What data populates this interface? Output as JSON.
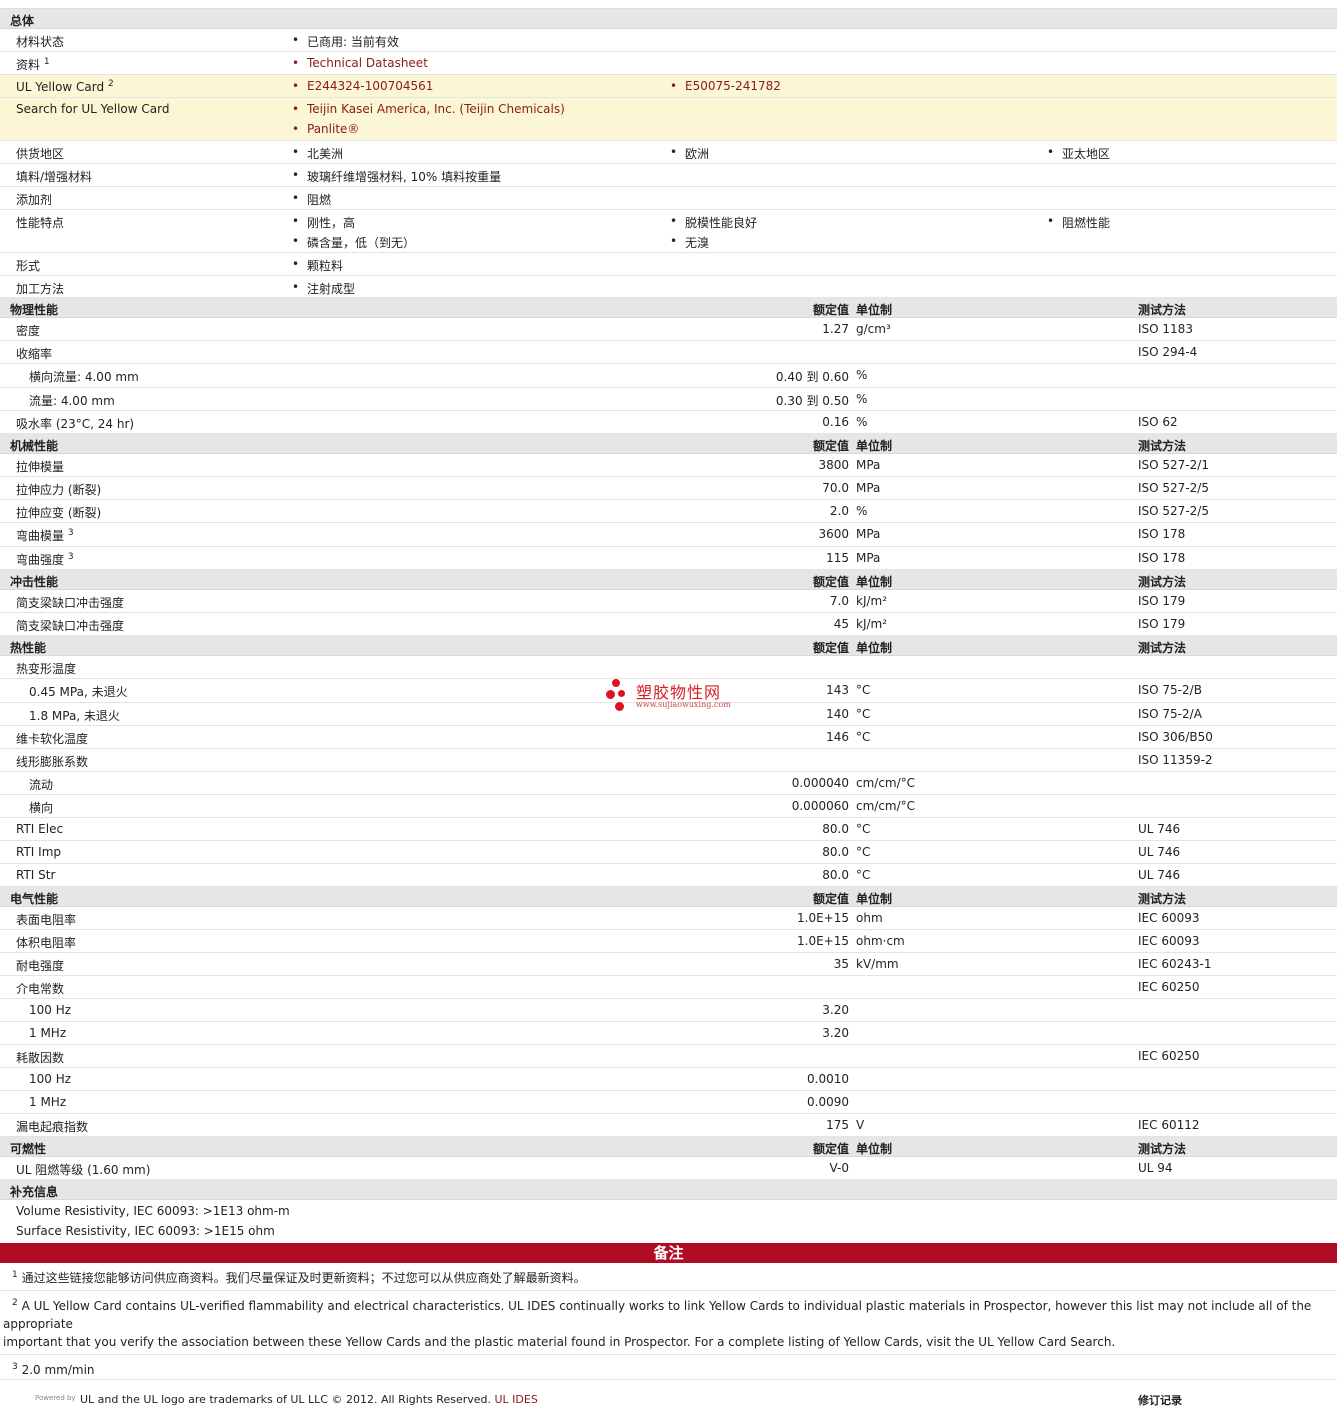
{
  "general": {
    "title": "总体",
    "status_label": "材料状态",
    "status_value": "已商用: 当前有效",
    "docs_label": "资料",
    "docs_sup": "1",
    "docs_link": "Technical Datasheet",
    "ulcard_label": "UL Yellow Card",
    "ulcard_sup": "2",
    "ulcard_link1": "E244324-100704561",
    "ulcard_link2": "E50075-241782",
    "search_label": "Search for UL Yellow Card",
    "search_link1": "Teijin Kasei America, Inc. (Teijin Chemicals)",
    "search_link2": "Panlite®",
    "region_label": "供货地区",
    "region": [
      "北美洲",
      "欧洲",
      "亚太地区"
    ],
    "filler_label": "填料/增强材料",
    "filler_value": "玻璃纤维增强材料, 10% 填料按重量",
    "additive_label": "添加剂",
    "additive_value": "阻燃",
    "features_label": "性能特点",
    "features": [
      "刚性，高",
      "脱模性能良好",
      "阻燃性能",
      "磷含量，低（到无）",
      "无溴"
    ],
    "form_label": "形式",
    "form_value": "颗粒料",
    "process_label": "加工方法",
    "process_value": "注射成型"
  },
  "headers": {
    "nominal": "额定值",
    "unit": "单位制",
    "method": "测试方法"
  },
  "physical": {
    "title": "物理性能",
    "rows": [
      {
        "label": "密度",
        "value": "1.27",
        "unit": "g/cm³",
        "method": "ISO 1183"
      },
      {
        "label": "收缩率",
        "value": "",
        "unit": "",
        "method": "ISO 294-4"
      },
      {
        "label": "横向流量: 4.00 mm",
        "value": "0.40 到  0.60",
        "unit": "%",
        "method": ""
      },
      {
        "label": "流量: 4.00 mm",
        "value": "0.30 到  0.50",
        "unit": "%",
        "method": ""
      },
      {
        "label": "吸水率  (23°C, 24 hr)",
        "value": "0.16",
        "unit": "%",
        "method": "ISO 62"
      }
    ]
  },
  "mechanical": {
    "title": "机械性能",
    "rows": [
      {
        "label": "拉伸模量",
        "value": "3800",
        "unit": "MPa",
        "method": "ISO 527-2/1"
      },
      {
        "label": "拉伸应力  (断裂)",
        "value": "70.0",
        "unit": "MPa",
        "method": "ISO 527-2/5"
      },
      {
        "label": "拉伸应变  (断裂)",
        "value": "2.0",
        "unit": "%",
        "method": "ISO 527-2/5"
      },
      {
        "label": "弯曲模量",
        "sup": "3",
        "value": "3600",
        "unit": "MPa",
        "method": "ISO 178"
      },
      {
        "label": "弯曲强度",
        "sup": "3",
        "value": "115",
        "unit": "MPa",
        "method": "ISO 178"
      }
    ]
  },
  "impact": {
    "title": "冲击性能",
    "rows": [
      {
        "label": "简支梁缺口冲击强度",
        "value": "7.0",
        "unit": "kJ/m²",
        "method": "ISO 179"
      },
      {
        "label": "简支梁缺口冲击强度",
        "value": "45",
        "unit": "kJ/m²",
        "method": "ISO 179"
      }
    ]
  },
  "thermal": {
    "title": "热性能",
    "rows": [
      {
        "label": "热变形温度",
        "value": "",
        "unit": "",
        "method": ""
      },
      {
        "label": "0.45 MPa, 未退火",
        "value": "143",
        "unit": "°C",
        "method": "ISO 75-2/B"
      },
      {
        "label": "1.8 MPa, 未退火",
        "value": "140",
        "unit": "°C",
        "method": "ISO 75-2/A"
      },
      {
        "label": "维卡软化温度",
        "value": "146",
        "unit": "°C",
        "method": "ISO 306/B50"
      },
      {
        "label": "线形膨胀系数",
        "value": "",
        "unit": "",
        "method": "ISO 11359-2"
      },
      {
        "label": "流动",
        "value": "0.000040",
        "unit": "cm/cm/°C",
        "method": ""
      },
      {
        "label": "横向",
        "value": "0.000060",
        "unit": "cm/cm/°C",
        "method": ""
      },
      {
        "label": "RTI Elec",
        "value": "80.0",
        "unit": "°C",
        "method": "UL 746"
      },
      {
        "label": "RTI Imp",
        "value": "80.0",
        "unit": "°C",
        "method": "UL 746"
      },
      {
        "label": "RTI Str",
        "value": "80.0",
        "unit": "°C",
        "method": "UL 746"
      }
    ]
  },
  "electrical": {
    "title": "电气性能",
    "rows": [
      {
        "label": "表面电阻率",
        "value": "1.0E+15",
        "unit": "ohm",
        "method": "IEC 60093"
      },
      {
        "label": "体积电阻率",
        "value": "1.0E+15",
        "unit": "ohm·cm",
        "method": "IEC 60093"
      },
      {
        "label": "耐电强度",
        "value": "35",
        "unit": "kV/mm",
        "method": "IEC 60243-1"
      },
      {
        "label": "介电常数",
        "value": "",
        "unit": "",
        "method": "IEC 60250"
      },
      {
        "label": "100 Hz",
        "value": "3.20",
        "unit": "",
        "method": ""
      },
      {
        "label": "1 MHz",
        "value": "3.20",
        "unit": "",
        "method": ""
      },
      {
        "label": "耗散因数",
        "value": "",
        "unit": "",
        "method": "IEC 60250"
      },
      {
        "label": "100 Hz",
        "value": "0.0010",
        "unit": "",
        "method": ""
      },
      {
        "label": "1 MHz",
        "value": "0.0090",
        "unit": "",
        "method": ""
      },
      {
        "label": "漏电起痕指数",
        "value": "175",
        "unit": "V",
        "method": "IEC 60112"
      }
    ]
  },
  "flammability": {
    "title": "可燃性",
    "rows": [
      {
        "label": "UL 阻燃等级  (1.60 mm)",
        "value": "V-0",
        "unit": "",
        "method": "UL 94"
      }
    ]
  },
  "supplement": {
    "title": "补充信息",
    "line1": "Volume Resistivity, IEC 60093: >1E13 ohm-m",
    "line2": "Surface Resistivity, IEC 60093: >1E15 ohm"
  },
  "notes": {
    "title": "备注",
    "n1_sup": "1",
    "n1": "通过这些链接您能够访问供应商资料。我们尽量保证及时更新资料；不过您可以从供应商处了解最新资料。",
    "n2_sup": "2",
    "n2": "A UL Yellow Card contains UL-verified flammability and electrical characteristics. UL IDES continually works to link Yellow Cards to individual plastic materials in Prospector, however this list may not include all of the appropriate",
    "n2b": "important that you verify the association between these Yellow Cards and the plastic material found in Prospector. For a complete listing of Yellow Cards, visit the UL Yellow Card Search.",
    "n3_sup": "3",
    "n3": "2.0 mm/min"
  },
  "footer": {
    "powered": "Powered by",
    "text": "UL and the UL logo are trademarks of UL LLC © 2012. All Rights Reserved.",
    "link": "UL IDES",
    "revision": "修订记录"
  },
  "watermark": {
    "name": "塑胶物性网",
    "url": "www.sujiaowuxing.com"
  }
}
